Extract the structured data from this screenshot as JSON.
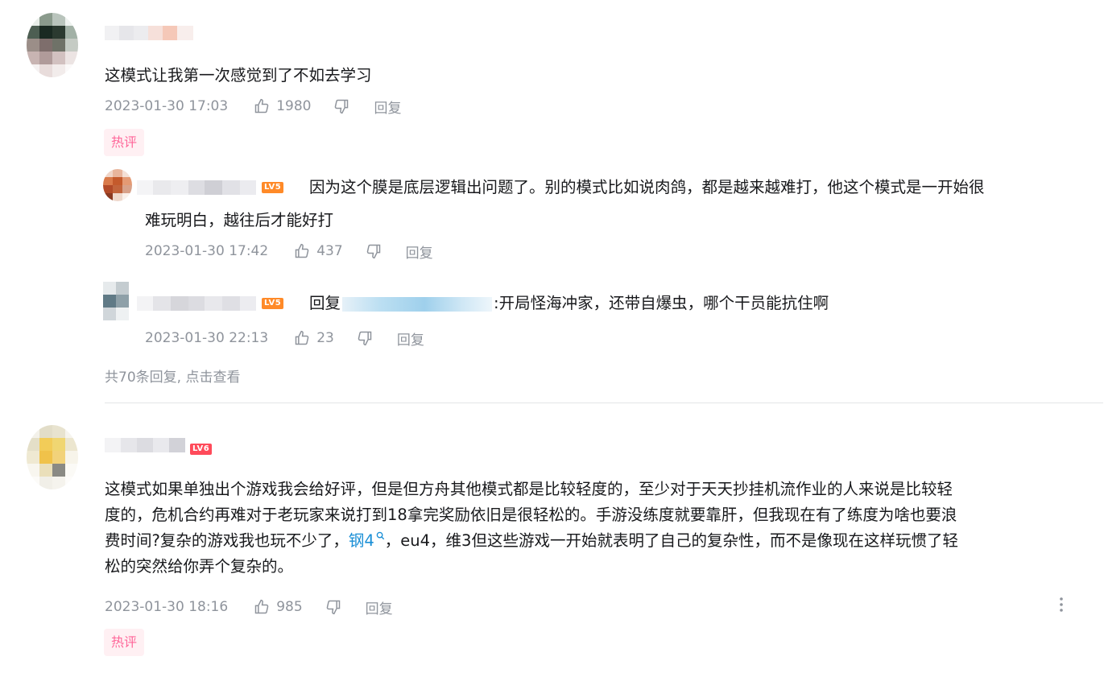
{
  "comments": [
    {
      "text": "这模式让我第一次感觉到了不如去学习",
      "time": "2023-01-30 17:03",
      "likes": "1980",
      "reply_label": "回复",
      "badge": "热评",
      "replies": [
        {
          "level": "LV5",
          "text_line1": "因为这个膜是底层逻辑出问题了。别的模式比如说肉鸽，都是越来越难打，他这个模式是一开始很",
          "text_line2": "难玩明白，越往后才能好打",
          "time": "2023-01-30 17:42",
          "likes": "437",
          "reply_label": "回复"
        },
        {
          "level": "LV5",
          "prefix": "回复",
          "text": ":开局怪海冲家，还带自爆虫，哪个干员能抗住啊",
          "time": "2023-01-30 22:13",
          "likes": "23",
          "reply_label": "回复"
        }
      ],
      "more_replies": "共70条回复, 点击查看"
    },
    {
      "level": "LV6",
      "text_line1": "这模式如果单独出个游戏我会给好评，但是但方舟其他模式都是比较轻度的，至少对于天天抄挂机流作业的人来说是比较轻",
      "text_line2": "度的，危机合约再难对于老玩家来说打到18拿完奖励依旧是很轻松的。手游没练度就要靠肝，但我现在有了练度为啥也要浪",
      "text_line3a": "费时间?复杂的游戏我也玩不少了，",
      "link_text": "钢4",
      "text_line3b": "，eu4，维3但这些游戏一开始就表明了自己的复杂性，而不是像现在这样玩惯了轻",
      "text_line4": "松的突然给你弄个复杂的。",
      "time": "2023-01-30 18:16",
      "likes": "985",
      "reply_label": "回复",
      "badge": "热评"
    }
  ],
  "icons": {
    "like": "thumb-up-icon",
    "dislike": "thumb-down-icon",
    "more": "more-vertical-icon",
    "search": "search-icon"
  },
  "colors": {
    "meta": "#8f949c",
    "hot_bg": "#fff0f3",
    "hot_text": "#ff6699",
    "link": "#1a8fd6",
    "lv5": "#ff8a28",
    "lv6": "#ff4a5a"
  }
}
